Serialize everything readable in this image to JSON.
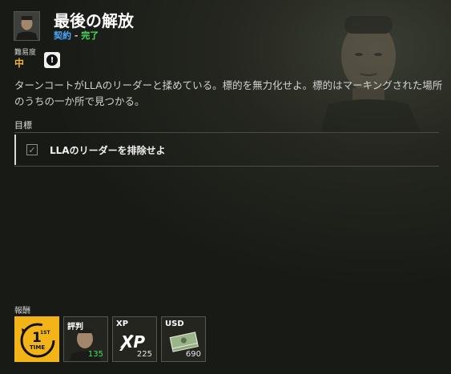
{
  "header": {
    "title": "最後の解放",
    "type_label": "契約",
    "separator": " - ",
    "status_label": "完了"
  },
  "difficulty": {
    "label": "難易度",
    "value": "中"
  },
  "warning_icon": "exclamation-circle-icon",
  "description": "ターンコートがLLAのリーダーと揉めている。標的を無力化せよ。標的はマーキングされた場所のうちの一か所で見つかる。",
  "objectives": {
    "label": "目標",
    "items": [
      {
        "text": "LLAのリーダーを排除せよ",
        "checked": true
      }
    ]
  },
  "rewards": {
    "label": "報酬",
    "items": [
      {
        "kind": "first-time",
        "badge_top": "1ST",
        "badge_bottom": "TIME",
        "icon": "first-time-badge-icon"
      },
      {
        "kind": "reputation",
        "title": "評判",
        "value": "135",
        "icon": "character-portrait"
      },
      {
        "kind": "xp",
        "title": "XP",
        "value": "225",
        "icon": "xp-logo-icon"
      },
      {
        "kind": "usd",
        "title": "USD",
        "value": "690",
        "icon": "cash-stack-icon"
      }
    ]
  },
  "colors": {
    "accent_gold": "#f3b417",
    "type_blue": "#4aa8ff",
    "status_green": "#46e05a",
    "difficulty_orange": "#f4b23c"
  }
}
